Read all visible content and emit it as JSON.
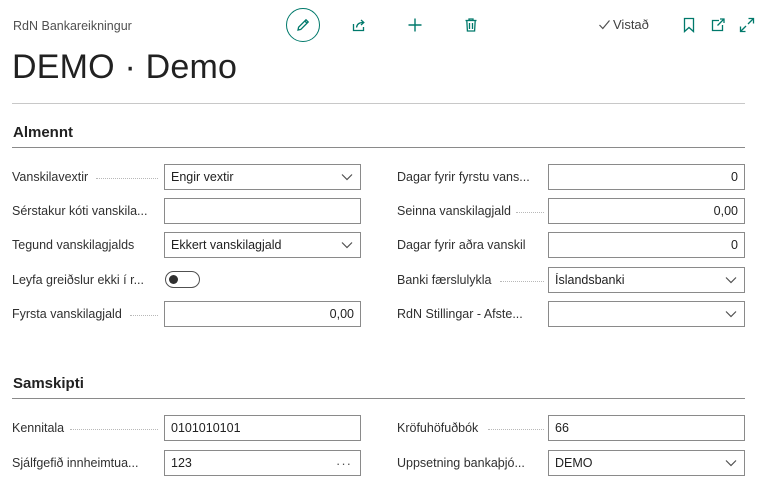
{
  "header": {
    "caption": "RdN Bankareikningur",
    "title": "DEMO · Demo",
    "saved_label": "Vistað"
  },
  "sections": {
    "almennt": {
      "heading": "Almennt",
      "fields": {
        "vanskilavextir": {
          "label": "Vanskilavextir",
          "value": "Engir vextir"
        },
        "serstakur_koti": {
          "label": "Sérstakur kóti vanskila...",
          "value": ""
        },
        "tegund": {
          "label": "Tegund vanskilagjalds",
          "value": "Ekkert vanskilagjald"
        },
        "leyfa": {
          "label": "Leyfa greiðslur ekki í r...",
          "value": false
        },
        "fyrsta": {
          "label": "Fyrsta vanskilagjald",
          "value": "0,00"
        },
        "dagar_fyrstu": {
          "label": "Dagar fyrir fyrstu vans...",
          "value": "0"
        },
        "seinna": {
          "label": "Seinna vanskilagjald",
          "value": "0,00"
        },
        "dagar_adra": {
          "label": "Dagar fyrir aðra vanskil",
          "value": "0"
        },
        "banki": {
          "label": "Banki færslulykla",
          "value": "Íslandsbanki"
        },
        "stillingar": {
          "label": "RdN Stillingar - Afste...",
          "value": ""
        }
      }
    },
    "samskipti": {
      "heading": "Samskipti",
      "fields": {
        "kennitala": {
          "label": "Kennitala",
          "value": "0101010101"
        },
        "sjalfgefid": {
          "label": "Sjálfgefið innheimtua...",
          "value": "123"
        },
        "krofuhofudbok": {
          "label": "Kröfuhöfuðbók",
          "value": "66"
        },
        "uppsetning": {
          "label": "Uppsetning bankaþjó...",
          "value": "DEMO"
        }
      }
    }
  },
  "icons": {
    "edit": "pencil-icon",
    "share": "share-icon",
    "new": "plus-icon",
    "delete": "trash-icon",
    "saved": "checkmark-icon",
    "bookmark": "bookmark-icon",
    "open_new": "open-in-new-window-icon",
    "expand": "expand-icon",
    "dropdown": "chevron-down-icon",
    "lookup": "ellipsis-icon"
  },
  "colors": {
    "accent": "#00796b",
    "text": "#212121",
    "border": "#8a8a8a"
  }
}
